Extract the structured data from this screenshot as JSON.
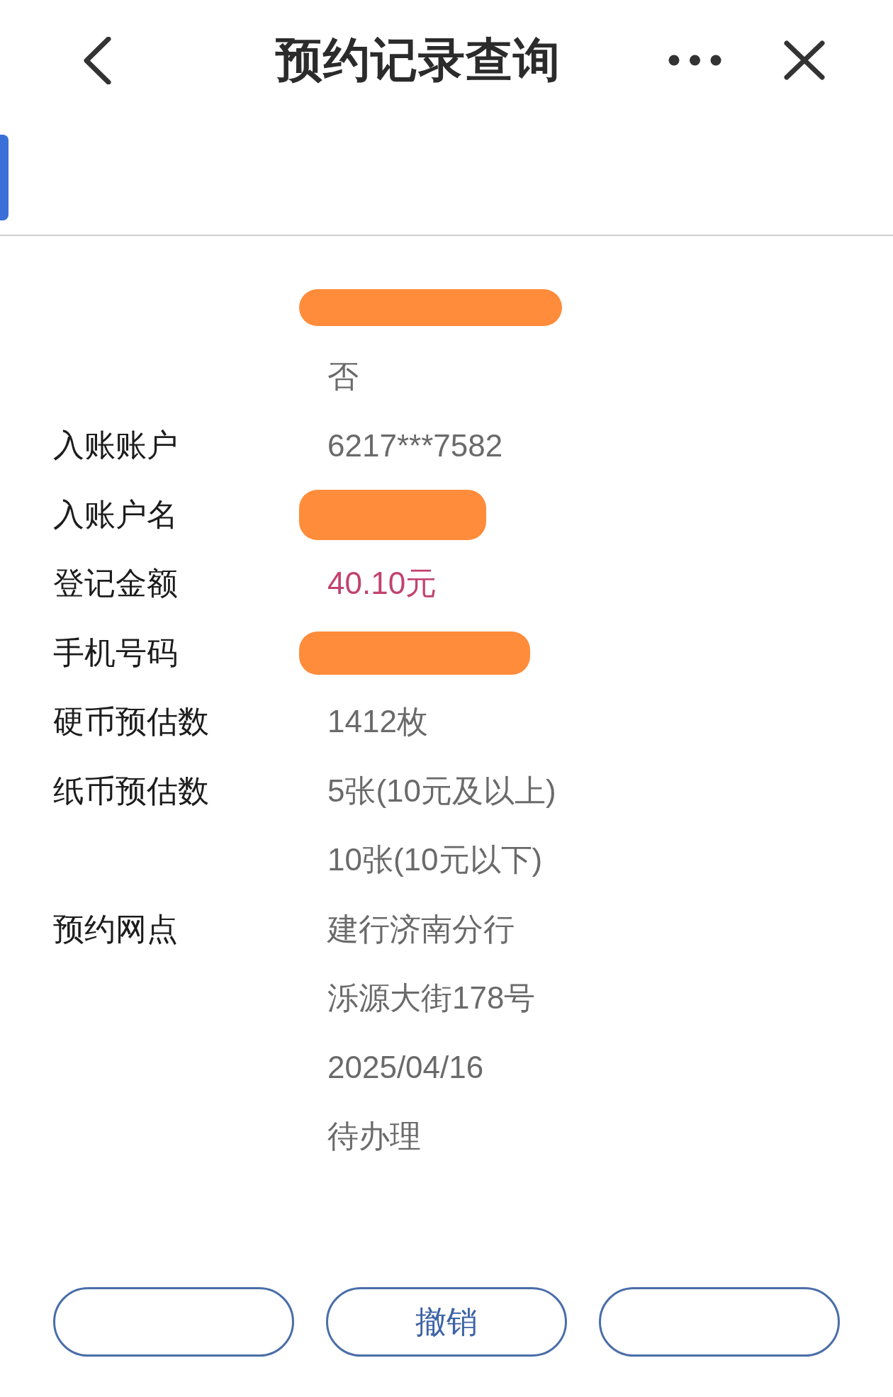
{
  "header": {
    "title": "预约记录查询"
  },
  "tab_bar": {
    "tabs": [
      {
        "selected": true
      }
    ]
  },
  "details": [
    {
      "kind": "redacted"
    },
    {
      "kind": "text",
      "value": "否"
    },
    {
      "kind": "text",
      "label": "入账账户",
      "value": "6217***7582"
    },
    {
      "kind": "redacted",
      "label": "入账户名"
    },
    {
      "kind": "amount",
      "label": "登记金额",
      "value": "40.10元"
    },
    {
      "kind": "redacted",
      "label": "手机号码"
    },
    {
      "kind": "text",
      "label": "硬币预估数",
      "value": "1412枚"
    },
    {
      "kind": "text",
      "label": "纸币预估数",
      "value": "5张(10元及以上)"
    },
    {
      "kind": "text",
      "value": "10张(10元以下)"
    },
    {
      "kind": "text",
      "label": "预约网点",
      "value": "建行济南分行"
    },
    {
      "kind": "text",
      "value": "泺源大街178号"
    },
    {
      "kind": "text",
      "value": "2025/04/16"
    },
    {
      "kind": "text",
      "value": "待办理"
    }
  ],
  "actions": [
    {
      "kind": "blank"
    },
    {
      "kind": "text",
      "label": "撤销"
    },
    {
      "kind": "blank"
    }
  ]
}
